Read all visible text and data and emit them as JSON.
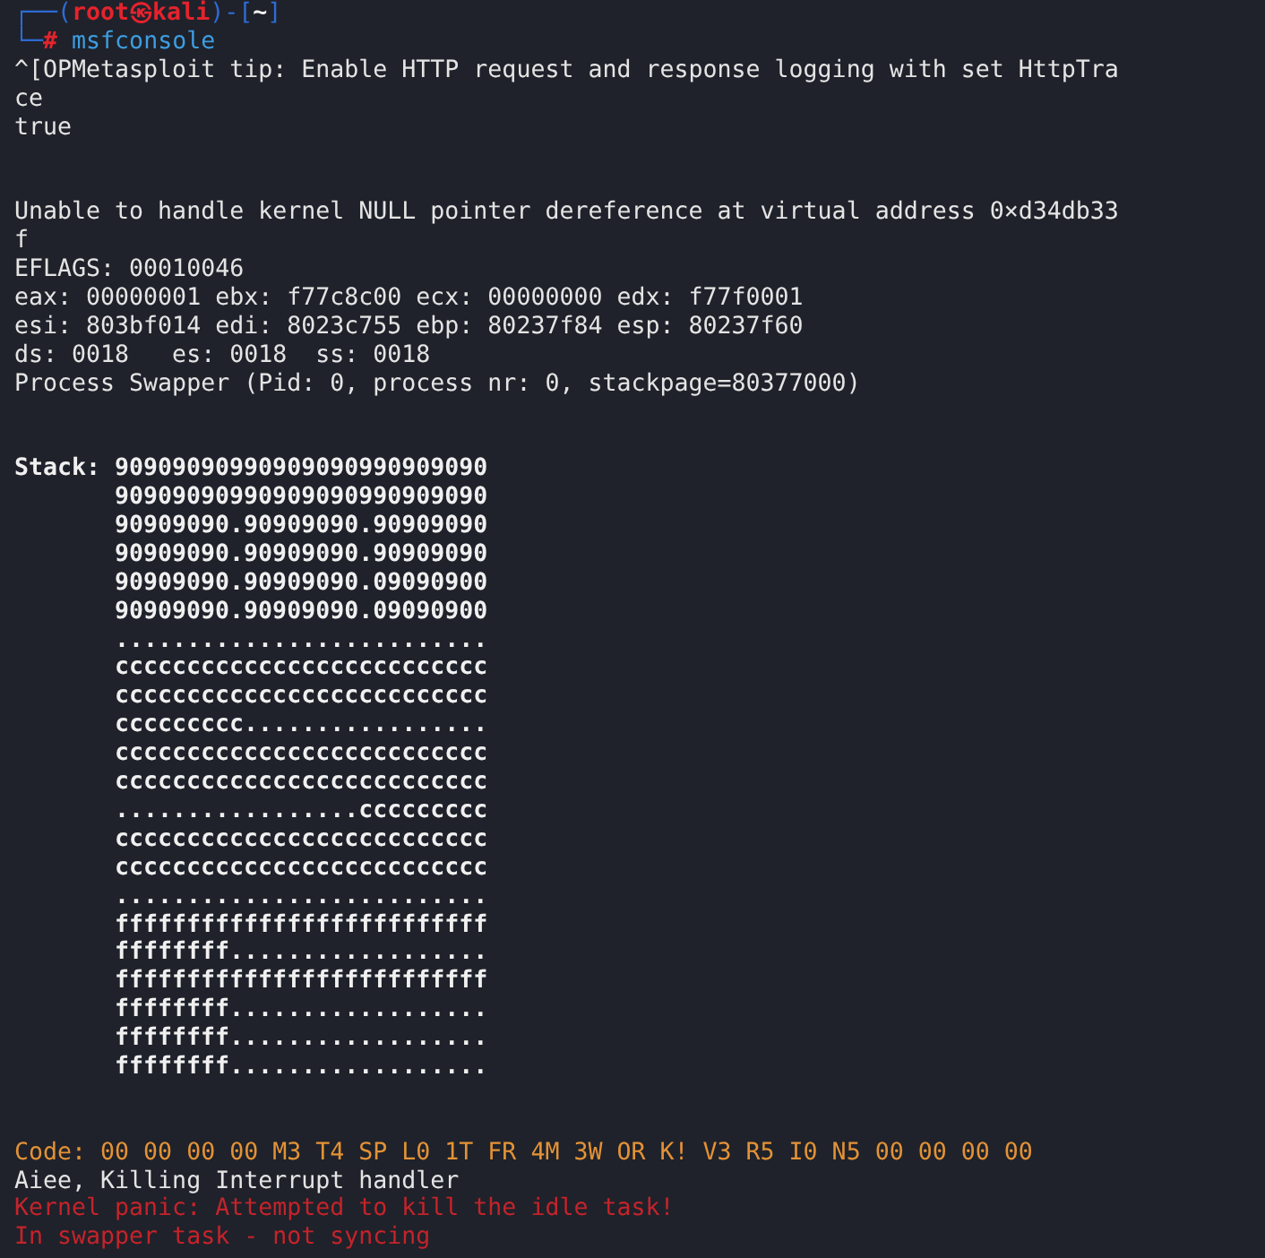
{
  "terminal": {
    "prompt": [
      {
        "segments": [
          {
            "text": "┌──(",
            "kind": "frame"
          },
          {
            "text": "root㉿kali",
            "kind": "user"
          },
          {
            "text": ")-[",
            "kind": "frame"
          },
          {
            "text": "~",
            "kind": "cwd"
          },
          {
            "text": "]",
            "kind": "frame"
          }
        ]
      },
      {
        "segments": [
          {
            "text": "└─",
            "kind": "frame"
          },
          {
            "text": "#",
            "kind": "user"
          },
          {
            "text": " msfconsole",
            "kind": "command"
          }
        ]
      }
    ],
    "lines": [
      {
        "kind": "output",
        "text": "^[OPMetasploit tip: Enable HTTP request and response logging with set HttpTra"
      },
      {
        "kind": "output",
        "text": "ce"
      },
      {
        "kind": "output",
        "text": "true"
      },
      {
        "kind": "blank"
      },
      {
        "kind": "blank"
      },
      {
        "kind": "output",
        "text": "Unable to handle kernel NULL pointer dereference at virtual address 0×d34db33"
      },
      {
        "kind": "output",
        "text": "f"
      },
      {
        "kind": "output",
        "text": "EFLAGS: 00010046"
      },
      {
        "kind": "output",
        "text": "eax: 00000001 ebx: f77c8c00 ecx: 00000000 edx: f77f0001"
      },
      {
        "kind": "output",
        "text": "esi: 803bf014 edi: 8023c755 ebp: 80237f84 esp: 80237f60"
      },
      {
        "kind": "output",
        "text": "ds: 0018   es: 0018  ss: 0018"
      },
      {
        "kind": "output",
        "text": "Process Swapper (Pid: 0, process nr: 0, stackpage=80377000)"
      },
      {
        "kind": "blank"
      },
      {
        "kind": "blank"
      },
      {
        "kind": "stack",
        "label": "Stack:",
        "rows": [
          "90909090990909090990909090",
          "90909090990909090990909090",
          "90909090.90909090.90909090",
          "90909090.90909090.90909090",
          "90909090.90909090.09090900",
          "90909090.90909090.09090900",
          "..........................",
          "cccccccccccccccccccccccccc",
          "cccccccccccccccccccccccccc",
          "ccccccccc.................",
          "cccccccccccccccccccccccccc",
          "cccccccccccccccccccccccccc",
          ".................ccccccccc",
          "cccccccccccccccccccccccccc",
          "cccccccccccccccccccccccccc",
          "..........................",
          "ffffffffffffffffffffffffff",
          "ffffffff..................",
          "ffffffffffffffffffffffffff",
          "ffffffff..................",
          "ffffffff..................",
          "ffffffff.................."
        ]
      },
      {
        "kind": "blank"
      },
      {
        "kind": "blank"
      },
      {
        "kind": "warning",
        "text": "Code: 00 00 00 00 M3 T4 SP L0 1T FR 4M 3W OR K! V3 R5 I0 N5 00 00 00 00"
      },
      {
        "kind": "output",
        "text": "Aiee, Killing Interrupt handler"
      },
      {
        "kind": "error",
        "text": "Kernel panic: Attempted to kill the idle task!"
      },
      {
        "kind": "error",
        "text": "In swapper task - not syncing"
      }
    ]
  }
}
